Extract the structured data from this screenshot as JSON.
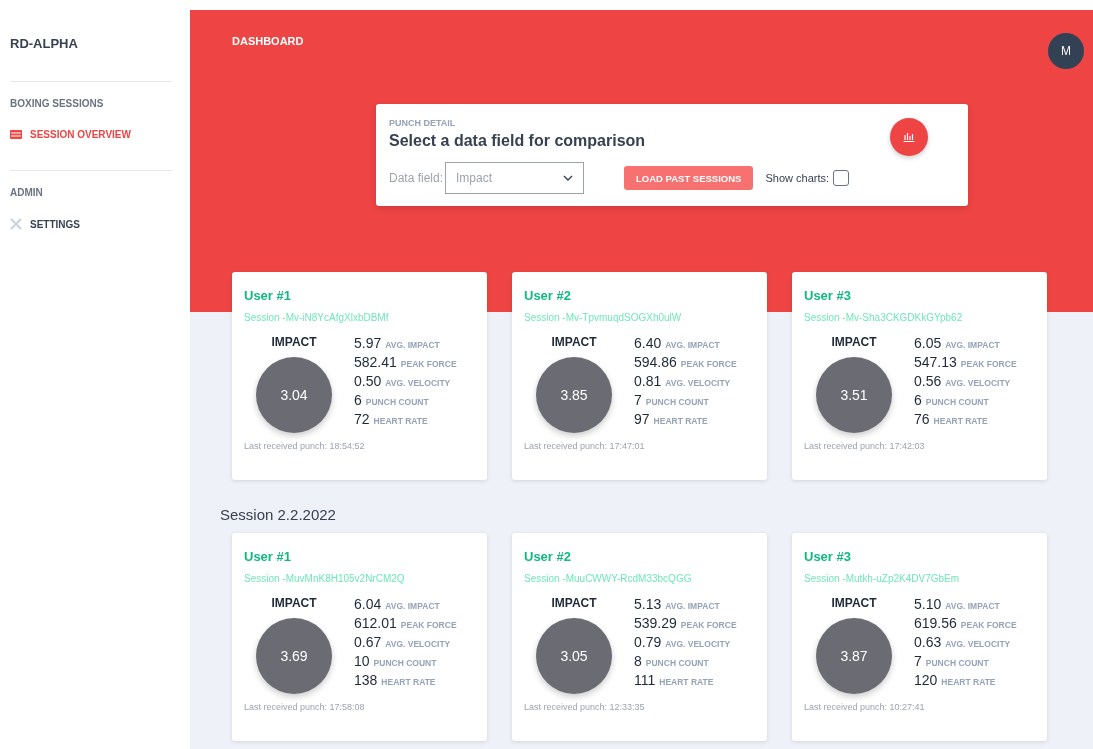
{
  "sidebar": {
    "brand": "RD-ALPHA",
    "sections": [
      {
        "title": "BOXING SESSIONS",
        "items": [
          {
            "label": "SESSION OVERVIEW",
            "selected": true
          }
        ]
      },
      {
        "title": "ADMIN",
        "items": [
          {
            "label": "SETTINGS",
            "selected": false
          }
        ]
      }
    ]
  },
  "header": {
    "title": "DASHBOARD",
    "avatar": "M"
  },
  "panel": {
    "eyebrow": "PUNCH DETAIL",
    "title": "Select a data field for comparison",
    "field_label": "Data field:",
    "field_value": "Impact",
    "button": "LOAD PAST SESSIONS",
    "checkbox_label": "Show charts:",
    "show_charts": false
  },
  "groups": [
    {
      "cards": [
        {
          "user": "User #1",
          "session": "Session -Mv-iN8YcAfgXlxbDBMf",
          "metric": "IMPACT",
          "score": "3.04",
          "stats": [
            {
              "value": "5.97",
              "label": "AVG. IMPACT"
            },
            {
              "value": "582.41",
              "label": "PEAK FORCE"
            },
            {
              "value": "0.50",
              "label": "AVG. VELOCITY"
            },
            {
              "value": "6",
              "label": "PUNCH COUNT"
            },
            {
              "value": "72",
              "label": "HEART RATE"
            }
          ],
          "last": "Last received punch: 18:54:52"
        },
        {
          "user": "User #2",
          "session": "Session -Mv-TpvmuqdSOGXh0ulW",
          "metric": "IMPACT",
          "score": "3.85",
          "stats": [
            {
              "value": "6.40",
              "label": "AVG. IMPACT"
            },
            {
              "value": "594.86",
              "label": "PEAK FORCE"
            },
            {
              "value": "0.81",
              "label": "AVG. VELOCITY"
            },
            {
              "value": "7",
              "label": "PUNCH COUNT"
            },
            {
              "value": "97",
              "label": "HEART RATE"
            }
          ],
          "last": "Last received punch: 17:47:01"
        },
        {
          "user": "User #3",
          "session": "Session -Mv-Sha3CKGDKkGYpb62",
          "metric": "IMPACT",
          "score": "3.51",
          "stats": [
            {
              "value": "6.05",
              "label": "AVG. IMPACT"
            },
            {
              "value": "547.13",
              "label": "PEAK FORCE"
            },
            {
              "value": "0.56",
              "label": "AVG. VELOCITY"
            },
            {
              "value": "6",
              "label": "PUNCH COUNT"
            },
            {
              "value": "76",
              "label": "HEART RATE"
            }
          ],
          "last": "Last received punch: 17:42:03"
        }
      ]
    },
    {
      "title": "Session 2.2.2022",
      "cards": [
        {
          "user": "User #1",
          "session": "Session -MuvMnK8H105v2NrCM2Q",
          "metric": "IMPACT",
          "score": "3.69",
          "stats": [
            {
              "value": "6.04",
              "label": "AVG. IMPACT"
            },
            {
              "value": "612.01",
              "label": "PEAK FORCE"
            },
            {
              "value": "0.67",
              "label": "AVG. VELOCITY"
            },
            {
              "value": "10",
              "label": "PUNCH COUNT"
            },
            {
              "value": "138",
              "label": "HEART RATE"
            }
          ],
          "last": "Last received punch: 17:58:08"
        },
        {
          "user": "User #2",
          "session": "Session -MuuCWWY-RcdM33bcQGG",
          "metric": "IMPACT",
          "score": "3.05",
          "stats": [
            {
              "value": "5.13",
              "label": "AVG. IMPACT"
            },
            {
              "value": "539.29",
              "label": "PEAK FORCE"
            },
            {
              "value": "0.79",
              "label": "AVG. VELOCITY"
            },
            {
              "value": "8",
              "label": "PUNCH COUNT"
            },
            {
              "value": "111",
              "label": "HEART RATE"
            }
          ],
          "last": "Last received punch: 12:33:35"
        },
        {
          "user": "User #3",
          "session": "Session -Mutkh-uZp2K4DV7GbEm",
          "metric": "IMPACT",
          "score": "3.87",
          "stats": [
            {
              "value": "5.10",
              "label": "AVG. IMPACT"
            },
            {
              "value": "619.56",
              "label": "PEAK FORCE"
            },
            {
              "value": "0.63",
              "label": "AVG. VELOCITY"
            },
            {
              "value": "7",
              "label": "PUNCH COUNT"
            },
            {
              "value": "120",
              "label": "HEART RATE"
            }
          ],
          "last": "Last received punch: 10:27:41"
        }
      ]
    }
  ]
}
